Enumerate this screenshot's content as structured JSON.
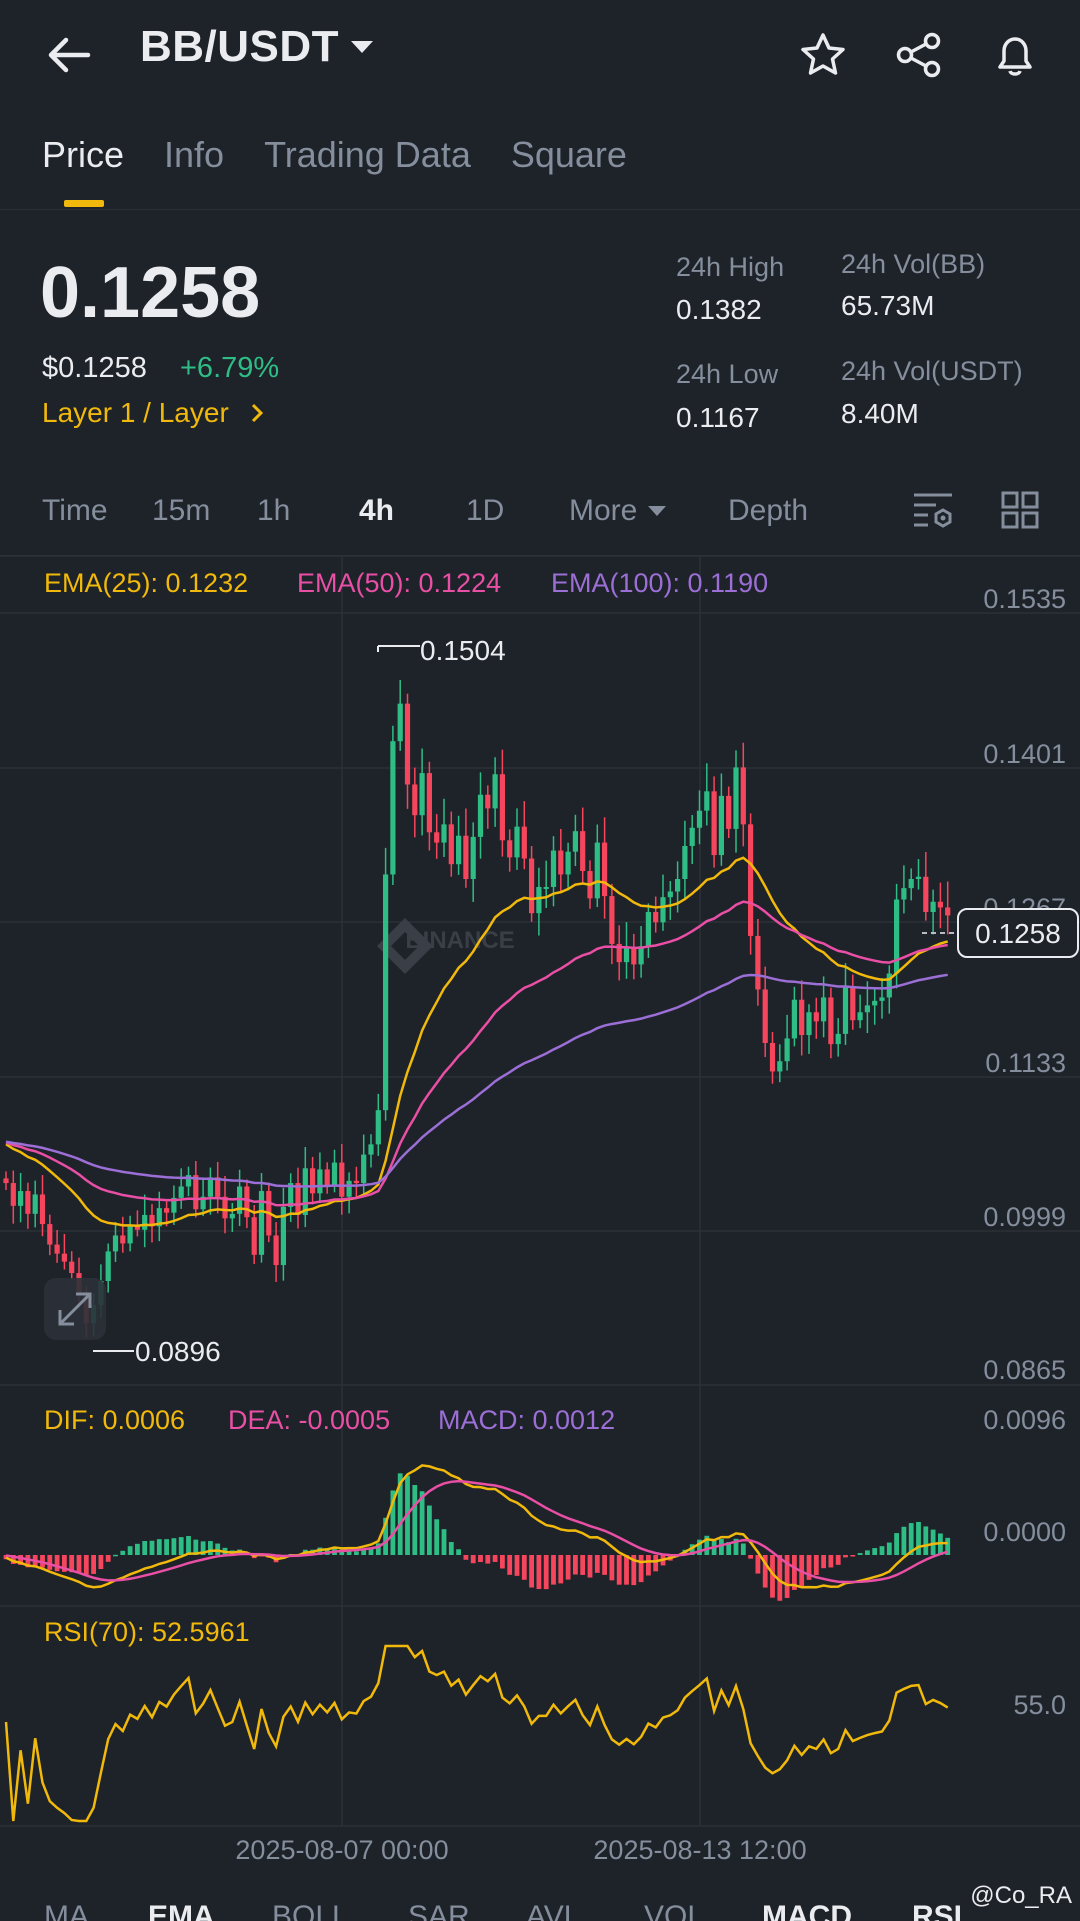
{
  "header": {
    "pair": "BB/USDT"
  },
  "tabs": [
    {
      "label": "Price",
      "active": true
    },
    {
      "label": "Info"
    },
    {
      "label": "Trading Data"
    },
    {
      "label": "Square"
    }
  ],
  "price": {
    "last": "0.1258",
    "fiat": "$0.1258",
    "change": "+6.79%",
    "tag": "Layer 1 / Layer"
  },
  "stats": {
    "high_label": "24h High",
    "high": "0.1382",
    "low_label": "24h Low",
    "low": "0.1167",
    "vol_base_label": "24h Vol(BB)",
    "vol_base": "65.73M",
    "vol_quote_label": "24h Vol(USDT)",
    "vol_quote": "8.40M"
  },
  "intervals": [
    "Time",
    "15m",
    "1h",
    "4h",
    "1D",
    "More",
    "Depth"
  ],
  "active_interval": "4h",
  "indicators": {
    "ema25": "EMA(25): 0.1232",
    "ema50": "EMA(50): 0.1224",
    "ema100": "EMA(100): 0.1190",
    "dif": "DIF: 0.0006",
    "dea": "DEA: -0.0005",
    "macd": "MACD: 0.0012",
    "rsi": "RSI(70): 52.5961"
  },
  "axis": {
    "price_ticks": [
      "0.1535",
      "0.1401",
      "0.1267",
      "0.1133",
      "0.0999",
      "0.0865"
    ],
    "macd_ticks": [
      "0.0096",
      "0.0000"
    ],
    "rsi_ticks": [
      "55.0"
    ],
    "time_ticks": [
      "2025-08-07 00:00",
      "2025-08-13 12:00"
    ],
    "high_marker": "0.1504",
    "low_marker": "0.0896",
    "last_price_label": "0.1258"
  },
  "watermark_text": "BINANCE",
  "bottom_tabs": [
    "MA",
    "EMA",
    "BOLL",
    "SAR",
    "AVL",
    "VOL",
    "MACD",
    "RSI"
  ],
  "bottom_active": [
    "EMA",
    "MACD"
  ],
  "overlay_credit": "@Co_RA",
  "colors": {
    "bg": "#1e2229",
    "up": "#2ebd85",
    "down": "#f6465d",
    "ema25": "#f0b90b",
    "ema50": "#e84fa5",
    "ema100": "#9b6fd6",
    "accent": "#f0b90b"
  },
  "chart_data": {
    "type": "candlestick",
    "price_range": [
      0.0865,
      0.1535
    ],
    "closes": [
      0.1023,
      0.1003,
      0.1016,
      0.0996,
      0.1013,
      0.0987,
      0.0969,
      0.0961,
      0.0954,
      0.0944,
      0.0927,
      0.09,
      0.0916,
      0.0937,
      0.0963,
      0.0977,
      0.097,
      0.0986,
      0.0982,
      0.0995,
      0.0985,
      0.1001,
      0.0997,
      0.101,
      0.102,
      0.103,
      0.1,
      0.1011,
      0.1028,
      0.1011,
      0.0992,
      0.0996,
      0.102,
      0.0993,
      0.096,
      0.1016,
      0.0977,
      0.0951,
      0.1002,
      0.1023,
      0.0995,
      0.1036,
      0.1014,
      0.1035,
      0.1021,
      0.1041,
      0.1011,
      0.1025,
      0.1023,
      0.1048,
      0.1057,
      0.1087,
      0.1294,
      0.1411,
      0.1444,
      0.1373,
      0.1346,
      0.1383,
      0.1331,
      0.1322,
      0.1338,
      0.1303,
      0.1328,
      0.129,
      0.1327,
      0.1364,
      0.1352,
      0.1382,
      0.1324,
      0.1309,
      0.1336,
      0.1308,
      0.126,
      0.1283,
      0.1283,
      0.1315,
      0.1294,
      0.1314,
      0.1332,
      0.1297,
      0.1273,
      0.1322,
      0.1275,
      0.1233,
      0.1217,
      0.123,
      0.1215,
      0.1231,
      0.1261,
      0.1252,
      0.1274,
      0.1279,
      0.129,
      0.1319,
      0.1335,
      0.135,
      0.1367,
      0.1311,
      0.1363,
      0.1334,
      0.1388,
      0.1338,
      0.124,
      0.1193,
      0.1146,
      0.1121,
      0.113,
      0.115,
      0.1184,
      0.1153,
      0.1173,
      0.1165,
      0.1186,
      0.1145,
      0.1154,
      0.1196,
      0.1166,
      0.1173,
      0.1179,
      0.1183,
      0.1186,
      0.1207,
      0.1272,
      0.1282,
      0.129,
      0.1292,
      0.1261,
      0.127,
      0.1265,
      0.1258
    ],
    "ema": {
      "EMA25": 0.1232,
      "EMA50": 0.1224,
      "EMA100": 0.119
    },
    "macd": {
      "DIF": 0.0006,
      "DEA": -0.0005,
      "MACD": 0.0012
    },
    "rsi": {
      "RSI70": 52.5961
    }
  }
}
